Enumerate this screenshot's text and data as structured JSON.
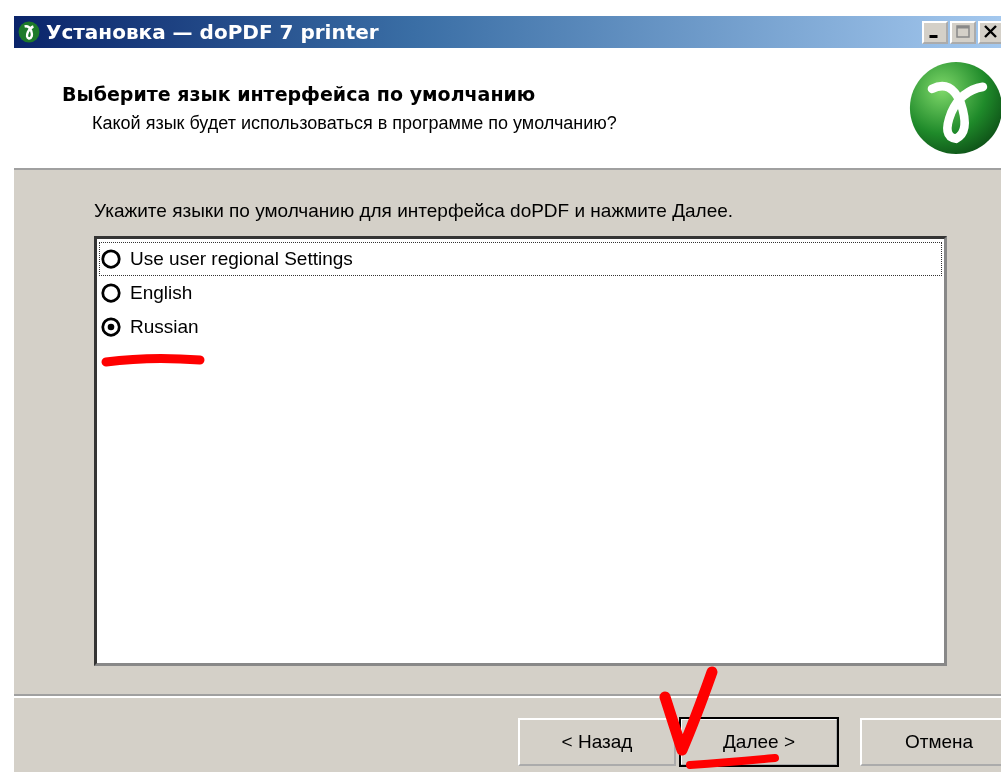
{
  "window": {
    "title": "Установка — doPDF 7 printer"
  },
  "header": {
    "title": "Выберите язык интерфейса по умолчанию",
    "subtitle": "Какой язык будет использоваться в программе по умолчанию?"
  },
  "instruction": "Укажите языки по умолчанию для интерфейса doPDF и нажмите Далее.",
  "languages": [
    {
      "label": "Use user regional Settings",
      "selected": false,
      "focused": true
    },
    {
      "label": "English",
      "selected": false,
      "focused": false
    },
    {
      "label": "Russian",
      "selected": true,
      "focused": false
    }
  ],
  "buttons": [
    {
      "label": "< Назад",
      "default": false
    },
    {
      "label": "Далее >",
      "default": true
    },
    {
      "label": "Отмена",
      "default": false
    }
  ]
}
